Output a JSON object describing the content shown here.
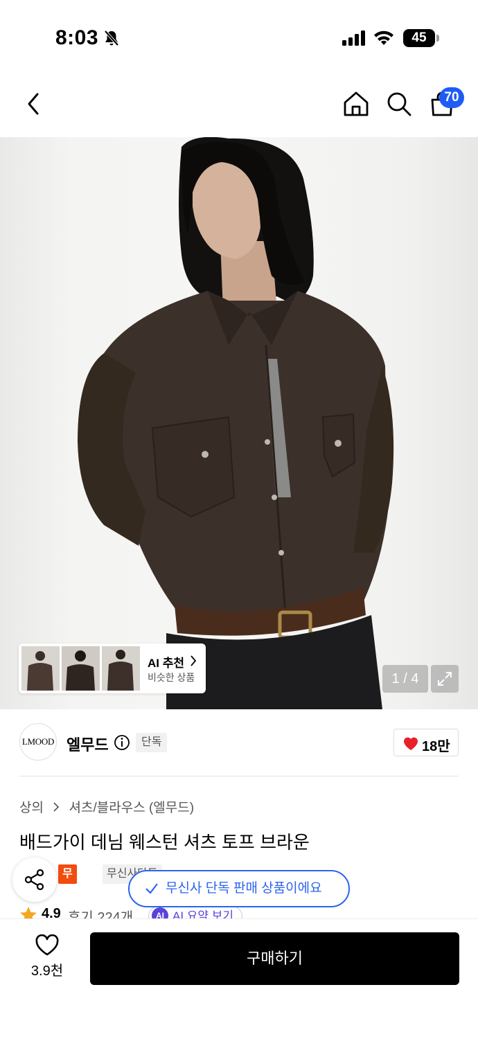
{
  "status_bar": {
    "time": "8:03",
    "battery": "45"
  },
  "nav": {
    "cart_count": "70"
  },
  "gallery": {
    "page_indicator": "1 / 4",
    "ai_reco_title": "AI 추천",
    "ai_reco_subtitle": "비슷한 상품"
  },
  "brand": {
    "logo_text": "LMOOD",
    "name": "엘무드",
    "exclusive_tag": "단독",
    "like_count": "18만"
  },
  "product": {
    "breadcrumb": [
      "상의",
      "셔츠/블라우스 (엘무드)"
    ],
    "title": "배드가이 데님 웨스턴 셔츠 토프 브라운",
    "tags": [
      "무진장",
      "무신사단독"
    ],
    "rating": "4.9",
    "reviews": "후기 224개",
    "ai_summary_icon": "AI",
    "ai_summary": "AI 요약 보기"
  },
  "toast": {
    "message": "무신사 단독 판매 상품이에요"
  },
  "bottom_bar": {
    "wish_count": "3.9천",
    "buy_label": "구매하기"
  },
  "colors": {
    "accent_blue": "#2b63f1",
    "badge_blue": "#1f5cf5",
    "tag_orange": "#f24c0f",
    "heart_red": "#e8202a",
    "ai_purple": "#5a43d8"
  }
}
